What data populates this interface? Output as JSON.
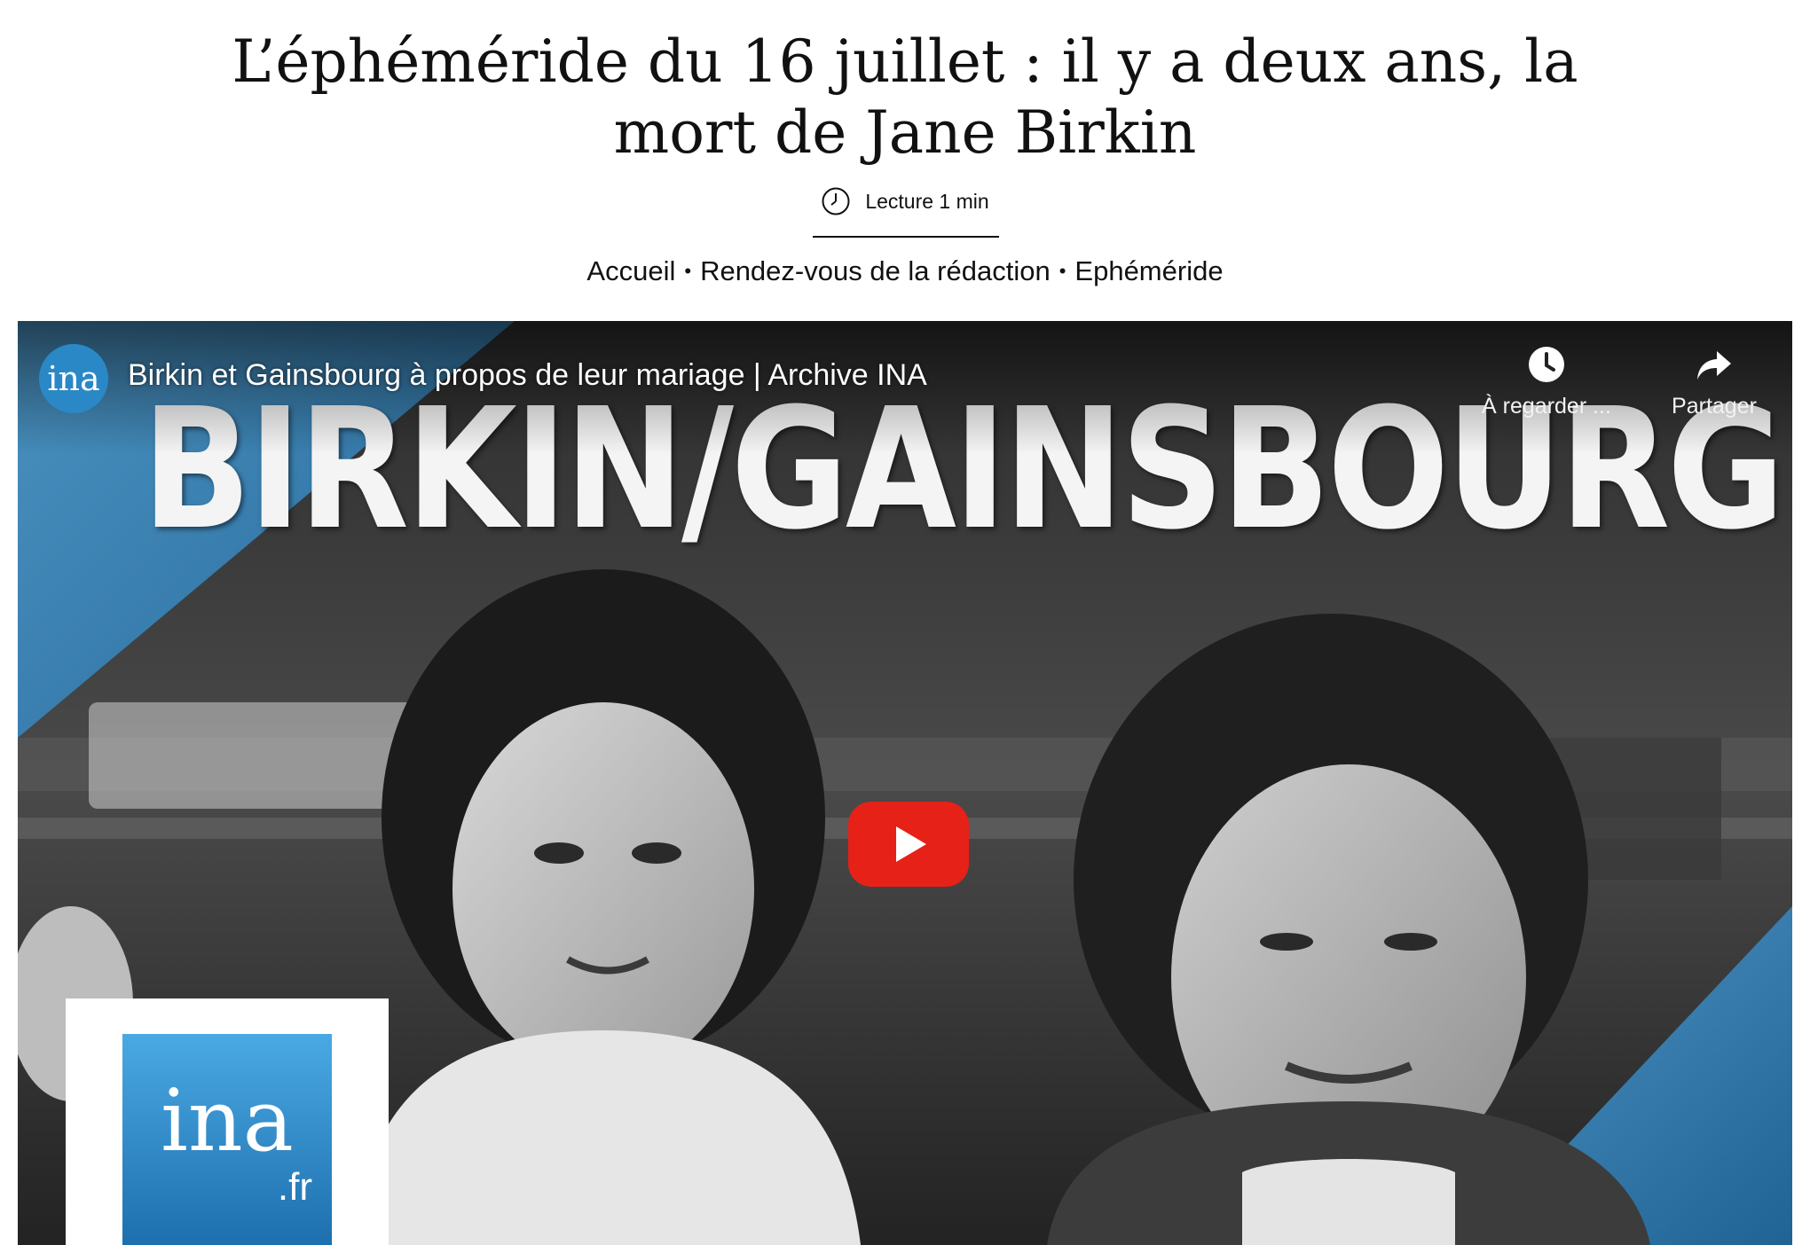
{
  "article": {
    "title": "L’éphéméride du 16 juillet : il y a deux ans, la mort de Jane Birkin",
    "reading_time": "Lecture 1 min",
    "breadcrumb": [
      "Accueil",
      "Rendez-vous de la rédaction",
      "Ephéméride"
    ],
    "breadcrumb_separator": "•"
  },
  "video": {
    "channel_avatar_text": "ina",
    "title": "Birkin et Gainsbourg à propos de leur mariage | Archive INA",
    "actions": {
      "watch_later": "À regarder ...",
      "share": "Partager"
    },
    "thumbnail_headline": "BIRKIN/GAINSBOURG",
    "thumbnail_logo_text": "ina",
    "thumbnail_logo_domain": ".fr",
    "colors": {
      "play_button": "#e62117",
      "ina_blue": "#2b88c6",
      "accent_triangle": "#3d8fc4"
    }
  }
}
